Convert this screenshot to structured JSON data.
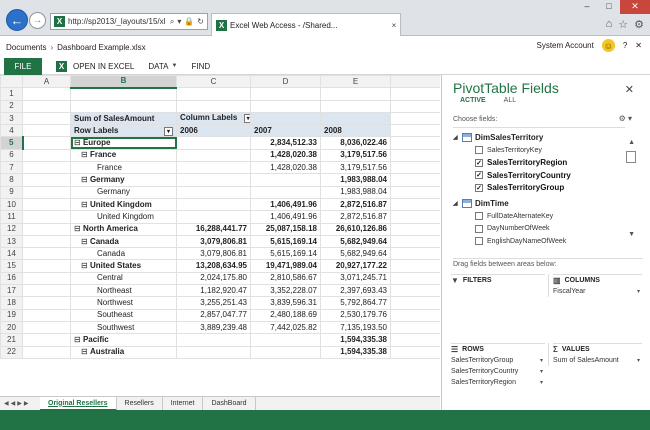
{
  "browser": {
    "url": "http://sp2013/_layouts/15/xl",
    "tab_title": "Excel Web Access - /Shared...",
    "back_label": "←",
    "forward_label": "→"
  },
  "sharepoint": {
    "breadcrumb": [
      "Documents",
      "Dashboard Example.xlsx"
    ],
    "user": "System Account"
  },
  "ribbon": {
    "file": "FILE",
    "open_in_excel": "OPEN IN EXCEL",
    "data": "DATA",
    "find": "FIND"
  },
  "grid": {
    "columns": [
      "A",
      "B",
      "C",
      "D",
      "E"
    ],
    "selected_column": "B",
    "selected_row": "5",
    "pivot_header": {
      "sum_label": "Sum of SalesAmount",
      "column_labels": "Column Labels",
      "row_labels": "Row Labels",
      "years": [
        "2006",
        "2007",
        "2008"
      ]
    },
    "rows": [
      {
        "n": "1",
        "label": "",
        "c": "",
        "d": "",
        "e": "",
        "style": "empty"
      },
      {
        "n": "2",
        "label": "",
        "c": "",
        "d": "",
        "e": "",
        "style": "empty"
      },
      {
        "n": "5",
        "label": "Europe",
        "c": "",
        "d": "2,834,512.33",
        "e": "8,036,022.46",
        "style": "lvl0"
      },
      {
        "n": "6",
        "label": "France",
        "c": "",
        "d": "1,428,020.38",
        "e": "3,179,517.56",
        "style": "lvl1"
      },
      {
        "n": "7",
        "label": "France",
        "c": "",
        "d": "1,428,020.38",
        "e": "3,179,517.56",
        "style": "lvl2"
      },
      {
        "n": "8",
        "label": "Germany",
        "c": "",
        "d": "",
        "e": "1,983,988.04",
        "style": "lvl1"
      },
      {
        "n": "9",
        "label": "Germany",
        "c": "",
        "d": "",
        "e": "1,983,988.04",
        "style": "lvl2"
      },
      {
        "n": "10",
        "label": "United Kingdom",
        "c": "",
        "d": "1,406,491.96",
        "e": "2,872,516.87",
        "style": "lvl1"
      },
      {
        "n": "11",
        "label": "United Kingdom",
        "c": "",
        "d": "1,406,491.96",
        "e": "2,872,516.87",
        "style": "lvl2"
      },
      {
        "n": "12",
        "label": "North America",
        "c": "16,288,441.77",
        "d": "25,087,158.18",
        "e": "26,610,126.86",
        "style": "lvl0"
      },
      {
        "n": "13",
        "label": "Canada",
        "c": "3,079,806.81",
        "d": "5,615,169.14",
        "e": "5,682,949.64",
        "style": "lvl1"
      },
      {
        "n": "14",
        "label": "Canada",
        "c": "3,079,806.81",
        "d": "5,615,169.14",
        "e": "5,682,949.64",
        "style": "lvl2"
      },
      {
        "n": "15",
        "label": "United States",
        "c": "13,208,634.95",
        "d": "19,471,989.04",
        "e": "20,927,177.22",
        "style": "lvl1"
      },
      {
        "n": "16",
        "label": "Central",
        "c": "2,024,175.80",
        "d": "2,810,586.67",
        "e": "3,071,245.71",
        "style": "lvl2"
      },
      {
        "n": "17",
        "label": "Northeast",
        "c": "1,182,920.47",
        "d": "3,352,228.07",
        "e": "2,397,693.43",
        "style": "lvl2"
      },
      {
        "n": "18",
        "label": "Northwest",
        "c": "3,255,251.43",
        "d": "3,839,596.31",
        "e": "5,792,864.77",
        "style": "lvl2"
      },
      {
        "n": "19",
        "label": "Southeast",
        "c": "2,857,047.77",
        "d": "2,480,188.69",
        "e": "2,530,179.76",
        "style": "lvl2"
      },
      {
        "n": "20",
        "label": "Southwest",
        "c": "3,889,239.48",
        "d": "7,442,025.82",
        "e": "7,135,193.50",
        "style": "lvl2"
      },
      {
        "n": "21",
        "label": "Pacific",
        "c": "",
        "d": "",
        "e": "1,594,335.38",
        "style": "lvl0"
      },
      {
        "n": "22",
        "label": "Australia",
        "c": "",
        "d": "",
        "e": "1,594,335.38",
        "style": "lvl1"
      }
    ]
  },
  "sheets": [
    "Original Resellers",
    "Resellers",
    "Internet",
    "DashBoard"
  ],
  "pivot": {
    "title": "PivotTable Fields",
    "tabs": [
      "ACTIVE",
      "ALL"
    ],
    "choose_fields": "Choose fields:",
    "groups": [
      {
        "name": "DimSalesTerritory",
        "fields": [
          {
            "label": "SalesTerritoryKey",
            "checked": false
          },
          {
            "label": "SalesTerritoryRegion",
            "checked": true
          },
          {
            "label": "SalesTerritoryCountry",
            "checked": true
          },
          {
            "label": "SalesTerritoryGroup",
            "checked": true
          }
        ]
      },
      {
        "name": "DimTime",
        "fields": [
          {
            "label": "FullDateAlternateKey",
            "checked": false
          },
          {
            "label": "DayNumberOfWeek",
            "checked": false
          },
          {
            "label": "EnglishDayNameOfWeek",
            "checked": false
          }
        ]
      }
    ],
    "drag_label": "Drag fields between areas below:",
    "areas": {
      "filters": {
        "title": "FILTERS",
        "items": []
      },
      "columns": {
        "title": "COLUMNS",
        "items": [
          "FiscalYear"
        ]
      },
      "rows": {
        "title": "ROWS",
        "items": [
          "SalesTerritoryGroup",
          "SalesTerritoryCountry",
          "SalesTerritoryRegion"
        ]
      },
      "values": {
        "title": "VALUES",
        "items": [
          "Sum of SalesAmount"
        ]
      }
    }
  },
  "colors": {
    "accent": "#217346",
    "pivot_header": "#dce6f1",
    "browser_back": "#2b70c9"
  }
}
